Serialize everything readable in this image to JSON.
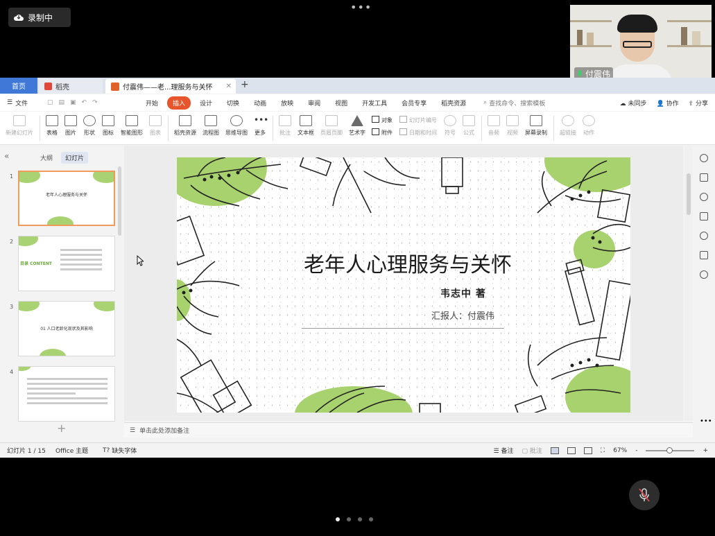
{
  "meeting": {
    "recording_label": "录制中",
    "participant_name": "付震伟",
    "colors": {
      "background": "#000000",
      "recording_badge": "#2a2a2a"
    }
  },
  "tabs": {
    "home": "首页",
    "docer": "稻壳",
    "file": "付震伟——老...理服务与关怀",
    "add": "+"
  },
  "menubar": {
    "file_label": "文件",
    "menus": [
      "开始",
      "插入",
      "设计",
      "切换",
      "动画",
      "放映",
      "审阅",
      "视图",
      "开发工具",
      "会员专享",
      "稻壳资源"
    ],
    "active_menu": "插入",
    "search_label": "查找命令、搜索模板",
    "sync_label": "未同步",
    "collab_label": "协作",
    "share_label": "分享"
  },
  "ribbon": {
    "new_slide": "新建幻灯片",
    "table": "表格",
    "picture": "图片",
    "shape": "形状",
    "icon": "图标",
    "smart_art": "智能图形",
    "chart": "图表",
    "docer_resources": "稻壳资源",
    "flowchart": "流程图",
    "mindmap": "思维导图",
    "more": "更多",
    "comment": "批注",
    "textbox": "文本框",
    "header_footer": "页眉页脚",
    "wordart": "艺术字",
    "object": "对象",
    "attachment": "附件",
    "slide_number": "幻灯片编号",
    "datetime": "日期和时间",
    "symbol": "符号",
    "formula": "公式",
    "audio": "音频",
    "video": "视频",
    "screen_record": "屏幕录制",
    "hyperlink": "超链接",
    "action": "动作"
  },
  "leftpanel": {
    "tab_outline": "大纲",
    "tab_slides": "幻灯片",
    "thumbnails": [
      {
        "num": "1",
        "title": "老年人心理服务与关怀"
      },
      {
        "num": "2",
        "title": "目录 CONTENT"
      },
      {
        "num": "3",
        "title": "01 人口老龄化现状及其影响"
      },
      {
        "num": "4",
        "title": ""
      }
    ],
    "add_slide": "+"
  },
  "slide": {
    "title": "老年人心理服务与关怀",
    "author": "韦志中  著",
    "reporter": "汇报人：付震伟",
    "accent_color": "#a8d26d"
  },
  "notes_placeholder": "单击此处添加备注",
  "status": {
    "slide_indicator": "幻灯片 1 / 15",
    "theme": "Office 主题",
    "missing_font": "缺失字体",
    "notes_btn": "备注",
    "comment_btn": "批注",
    "zoom": "67%",
    "zoom_minus": "-",
    "zoom_plus": "+"
  }
}
